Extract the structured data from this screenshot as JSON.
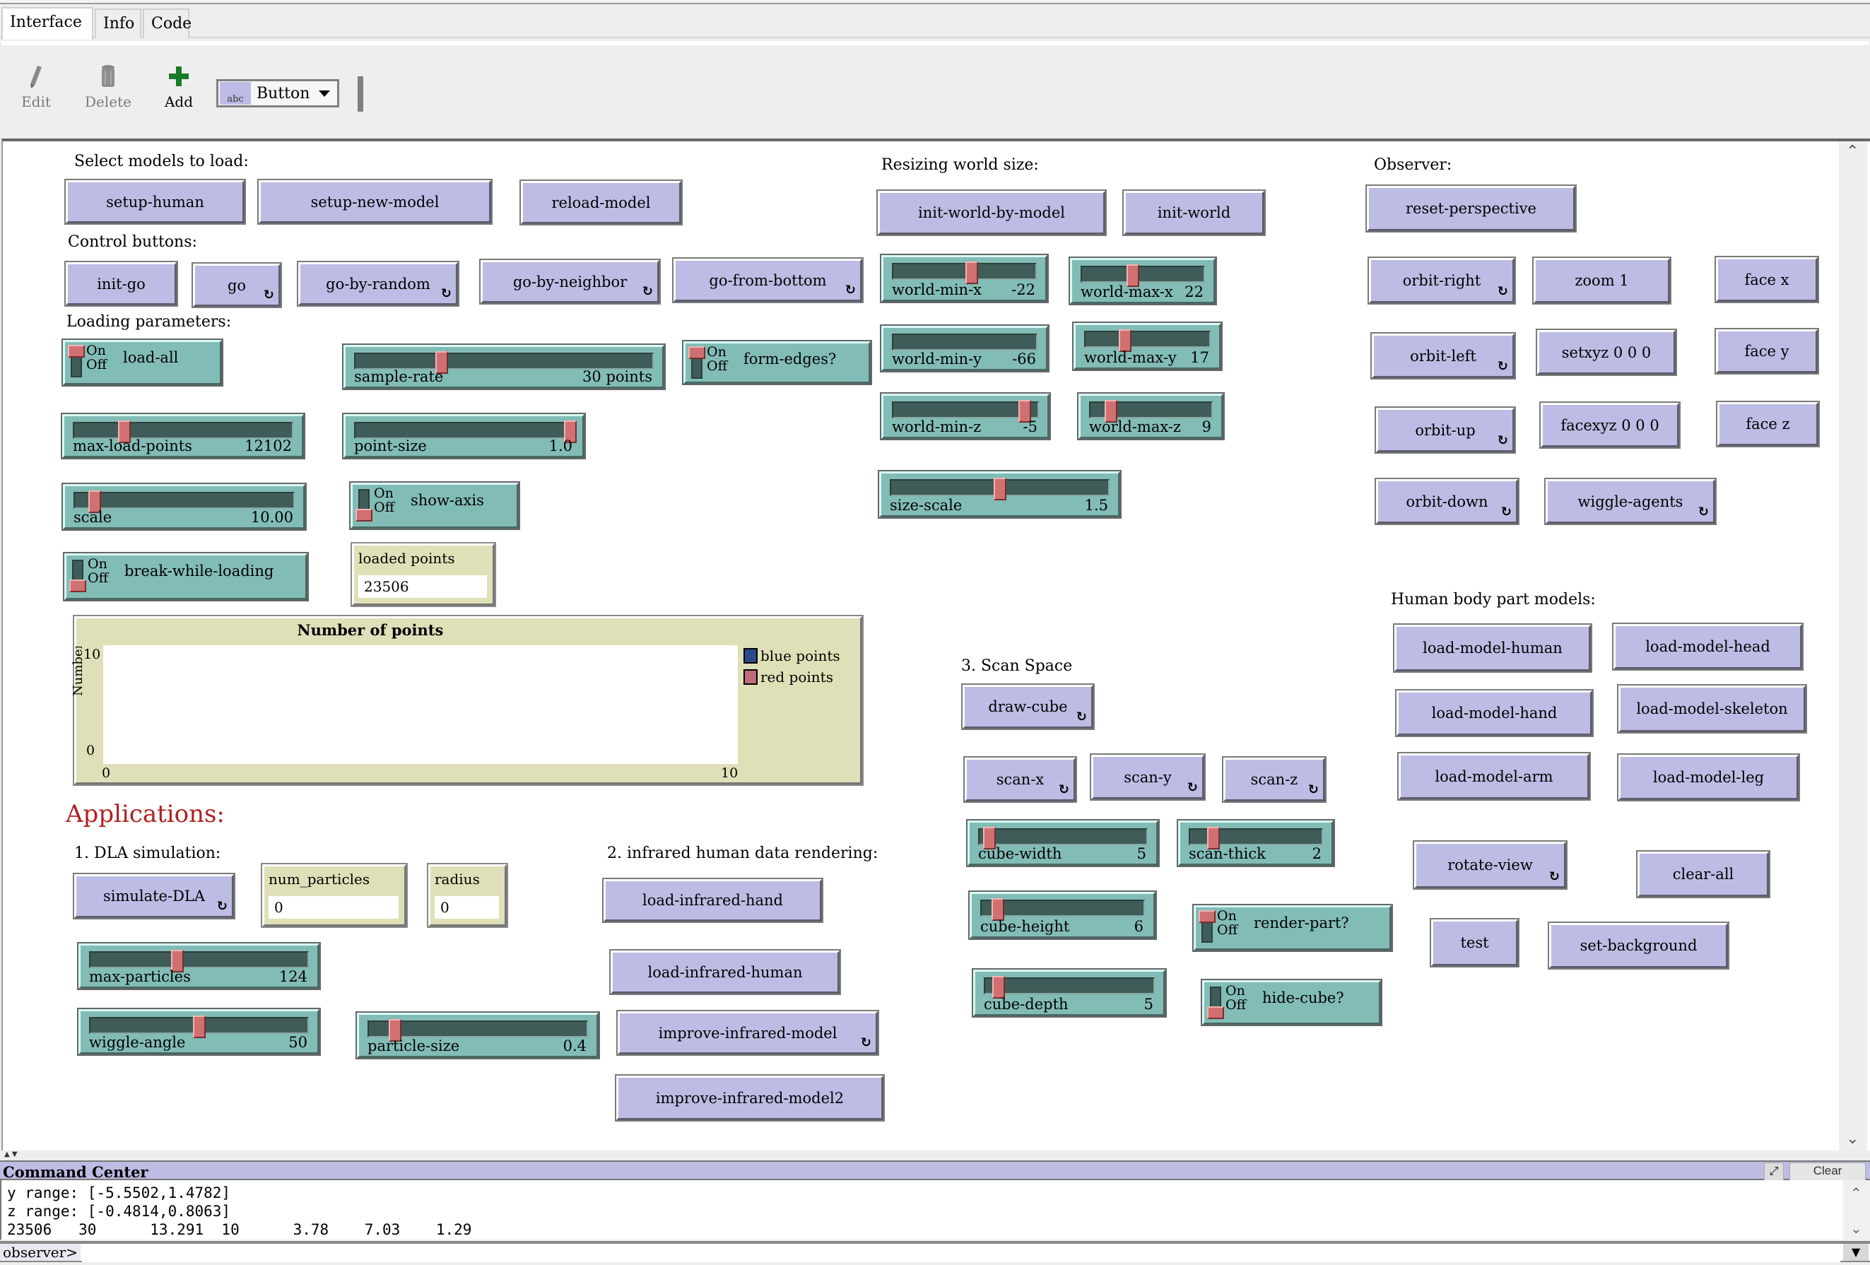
{
  "tabs": [
    {
      "label": "Interface",
      "active": true
    },
    {
      "label": "Info",
      "active": false
    },
    {
      "label": "Code",
      "active": false
    }
  ],
  "toolbar": {
    "edit_label": "Edit",
    "delete_label": "Delete",
    "add_label": "Add",
    "widget_type_icon": "abc",
    "widget_type": "Button"
  },
  "labels": {
    "select_models": "Select models to load:",
    "control_buttons": "Control buttons:",
    "loading_params": "Loading parameters:",
    "resizing": "Resizing world size:",
    "observer": "Observer:",
    "applications": "Applications:",
    "dla": "1. DLA simulation:",
    "infrared": "2. infrared human data rendering:",
    "scan_space": "3. Scan Space",
    "body_parts": "Human body part models:"
  },
  "buttons": {
    "setup_human": "setup-human",
    "setup_new_model": "setup-new-model",
    "reload_model": "reload-model",
    "init_go": "init-go",
    "go": "go",
    "go_by_random": "go-by-random",
    "go_by_neighbor": "go-by-neighbor",
    "go_from_bottom": "go-from-bottom",
    "init_world_by_model": "init-world-by-model",
    "init_world": "init-world",
    "reset_perspective": "reset-perspective",
    "orbit_right": "orbit-right",
    "zoom_1": "zoom 1",
    "face_x": "face x",
    "orbit_left": "orbit-left",
    "setxyz": "setxyz 0 0 0",
    "face_y": "face y",
    "orbit_up": "orbit-up",
    "facexyz": "facexyz 0 0 0",
    "face_z": "face z",
    "orbit_down": "orbit-down",
    "wiggle_agents": "wiggle-agents",
    "simulate_dla": "simulate-DLA",
    "load_infrared_hand": "load-infrared-hand",
    "load_infrared_human": "load-infrared-human",
    "improve_infrared_model": "improve-infrared-model",
    "improve_infrared_model2": "improve-infrared-model2",
    "draw_cube": "draw-cube",
    "scan_x": "scan-x",
    "scan_y": "scan-y",
    "scan_z": "scan-z",
    "load_model_human": "load-model-human",
    "load_model_head": "load-model-head",
    "load_model_hand": "load-model-hand",
    "load_model_skeleton": "load-model-skeleton",
    "load_model_arm": "load-model-arm",
    "load_model_leg": "load-model-leg",
    "rotate_view": "rotate-view",
    "clear_all": "clear-all",
    "test": "test",
    "set_background": "set-background",
    "forever_icon": "↻"
  },
  "sliders": {
    "sample_rate": {
      "name": "sample-rate",
      "value": "30 points",
      "fraction": 0.29
    },
    "max_load_points": {
      "name": "max-load-points",
      "value": "12102",
      "fraction": 0.23
    },
    "point_size": {
      "name": "point-size",
      "value": "1.0",
      "fraction": 0.99
    },
    "scale": {
      "name": "scale",
      "value": "10.00",
      "fraction": 0.09
    },
    "world_min_x": {
      "name": "world-min-x",
      "value": "-22",
      "fraction": 0.55
    },
    "world_max_x": {
      "name": "world-max-x",
      "value": "22",
      "fraction": 0.42
    },
    "world_min_y": {
      "name": "world-min-y",
      "value": "-66",
      "fraction": null
    },
    "world_max_y": {
      "name": "world-max-y",
      "value": "17",
      "fraction": 0.32
    },
    "world_min_z": {
      "name": "world-min-z",
      "value": "-5",
      "fraction": 0.91
    },
    "world_max_z": {
      "name": "world-max-z",
      "value": "9",
      "fraction": 0.17
    },
    "size_scale": {
      "name": "size-scale",
      "value": "1.5",
      "fraction": 0.5
    },
    "max_particles": {
      "name": "max-particles",
      "value": "124",
      "fraction": 0.4
    },
    "wiggle_angle": {
      "name": "wiggle-angle",
      "value": "50",
      "fraction": 0.5
    },
    "particle_size": {
      "name": "particle-size",
      "value": "0.4",
      "fraction": 0.12
    },
    "cube_width": {
      "name": "cube-width",
      "value": "5",
      "fraction": 0.06
    },
    "scan_thick": {
      "name": "scan-thick",
      "value": "2",
      "fraction": 0.18
    },
    "cube_height": {
      "name": "cube-height",
      "value": "6",
      "fraction": 0.1
    },
    "cube_depth": {
      "name": "cube-depth",
      "value": "5",
      "fraction": 0.08
    }
  },
  "switches": {
    "on_label": "On",
    "off_label": "Off",
    "load_all": {
      "name": "load-all",
      "on": true
    },
    "form_edges": {
      "name": "form-edges?",
      "on": true
    },
    "show_axis": {
      "name": "show-axis",
      "on": false
    },
    "break_while_loading": {
      "name": "break-while-loading",
      "on": false
    },
    "render_part": {
      "name": "render-part?",
      "on": true
    },
    "hide_cube": {
      "name": "hide-cube?",
      "on": false
    }
  },
  "monitors": {
    "loaded_points": {
      "name": "loaded points",
      "value": "23506"
    },
    "num_particles": {
      "name": "num_particles",
      "value": "0"
    },
    "radius": {
      "name": "radius",
      "value": "0"
    }
  },
  "chart_data": {
    "type": "line",
    "title": "Number of points",
    "xlabel": "",
    "ylabel": "Number of points",
    "xlim": [
      0,
      10
    ],
    "ylim": [
      0,
      10
    ],
    "x_ticks": [
      "0",
      "10"
    ],
    "y_ticks": [
      "0",
      "10"
    ],
    "legend_position": "right",
    "series": [
      {
        "name": "blue points",
        "color": "#2a4a8a",
        "values": []
      },
      {
        "name": "red points",
        "color": "#c06a7a",
        "values": []
      }
    ]
  },
  "command_center": {
    "title": "Command Center",
    "clear_label": "Clear",
    "output_lines": [
      "y range: [-5.5502,1.4782]",
      "z range: [-0.4814,0.8063]",
      "23506   30      13.291  10      3.78    7.03    1.29"
    ],
    "prompt": "observer>",
    "input_value": ""
  },
  "colors": {
    "button": "#bcbce4",
    "slider": "#82bcb6",
    "monitor": "#e0e0b8",
    "applications_heading": "#b02020"
  }
}
